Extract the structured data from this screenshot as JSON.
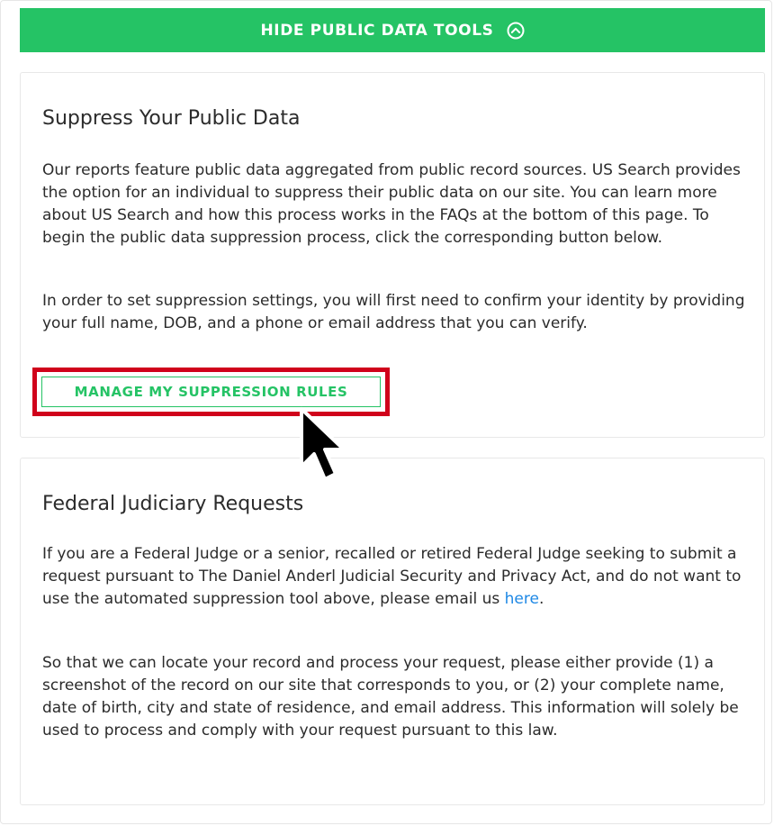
{
  "toolbar": {
    "toggle_label": "HIDE PUBLIC DATA TOOLS",
    "toggle_icon": "chevron-up-circle-icon"
  },
  "suppress": {
    "title": "Suppress Your Public Data",
    "para1": "Our reports feature public data aggregated from public record sources. US Search provides the option for an individual to suppress their public data on our site. You can learn more about US Search and how this process works in the FAQs at the bottom of this page. To begin the public data suppression process, click the corresponding button below.",
    "para2": "In order to set suppression settings, you will first need to confirm your identity by providing your full name, DOB, and a phone or email address that you can verify.",
    "button_label": "MANAGE MY SUPPRESSION RULES"
  },
  "judicial": {
    "title": "Federal Judiciary Requests",
    "para1_prefix": "If you are a Federal Judge or a senior, recalled or retired Federal Judge seeking to submit a request pursuant to The Daniel Anderl Judicial Security and Privacy Act, and do not want to use the automated suppression tool above, please email us ",
    "para1_link": "here",
    "para1_suffix": ".",
    "para2": "So that we can locate your record and process your request, please either provide (1) a screenshot of the record on our site that corresponds to you, or (2) your complete name, date of birth, city and state of residence, and email address. This information will solely be used to process and comply with your request pursuant to this law."
  },
  "colors": {
    "accent_green": "#25c365",
    "highlight_red": "#d0021b",
    "link_blue": "#1e88e5",
    "text": "#2b2b2b"
  }
}
